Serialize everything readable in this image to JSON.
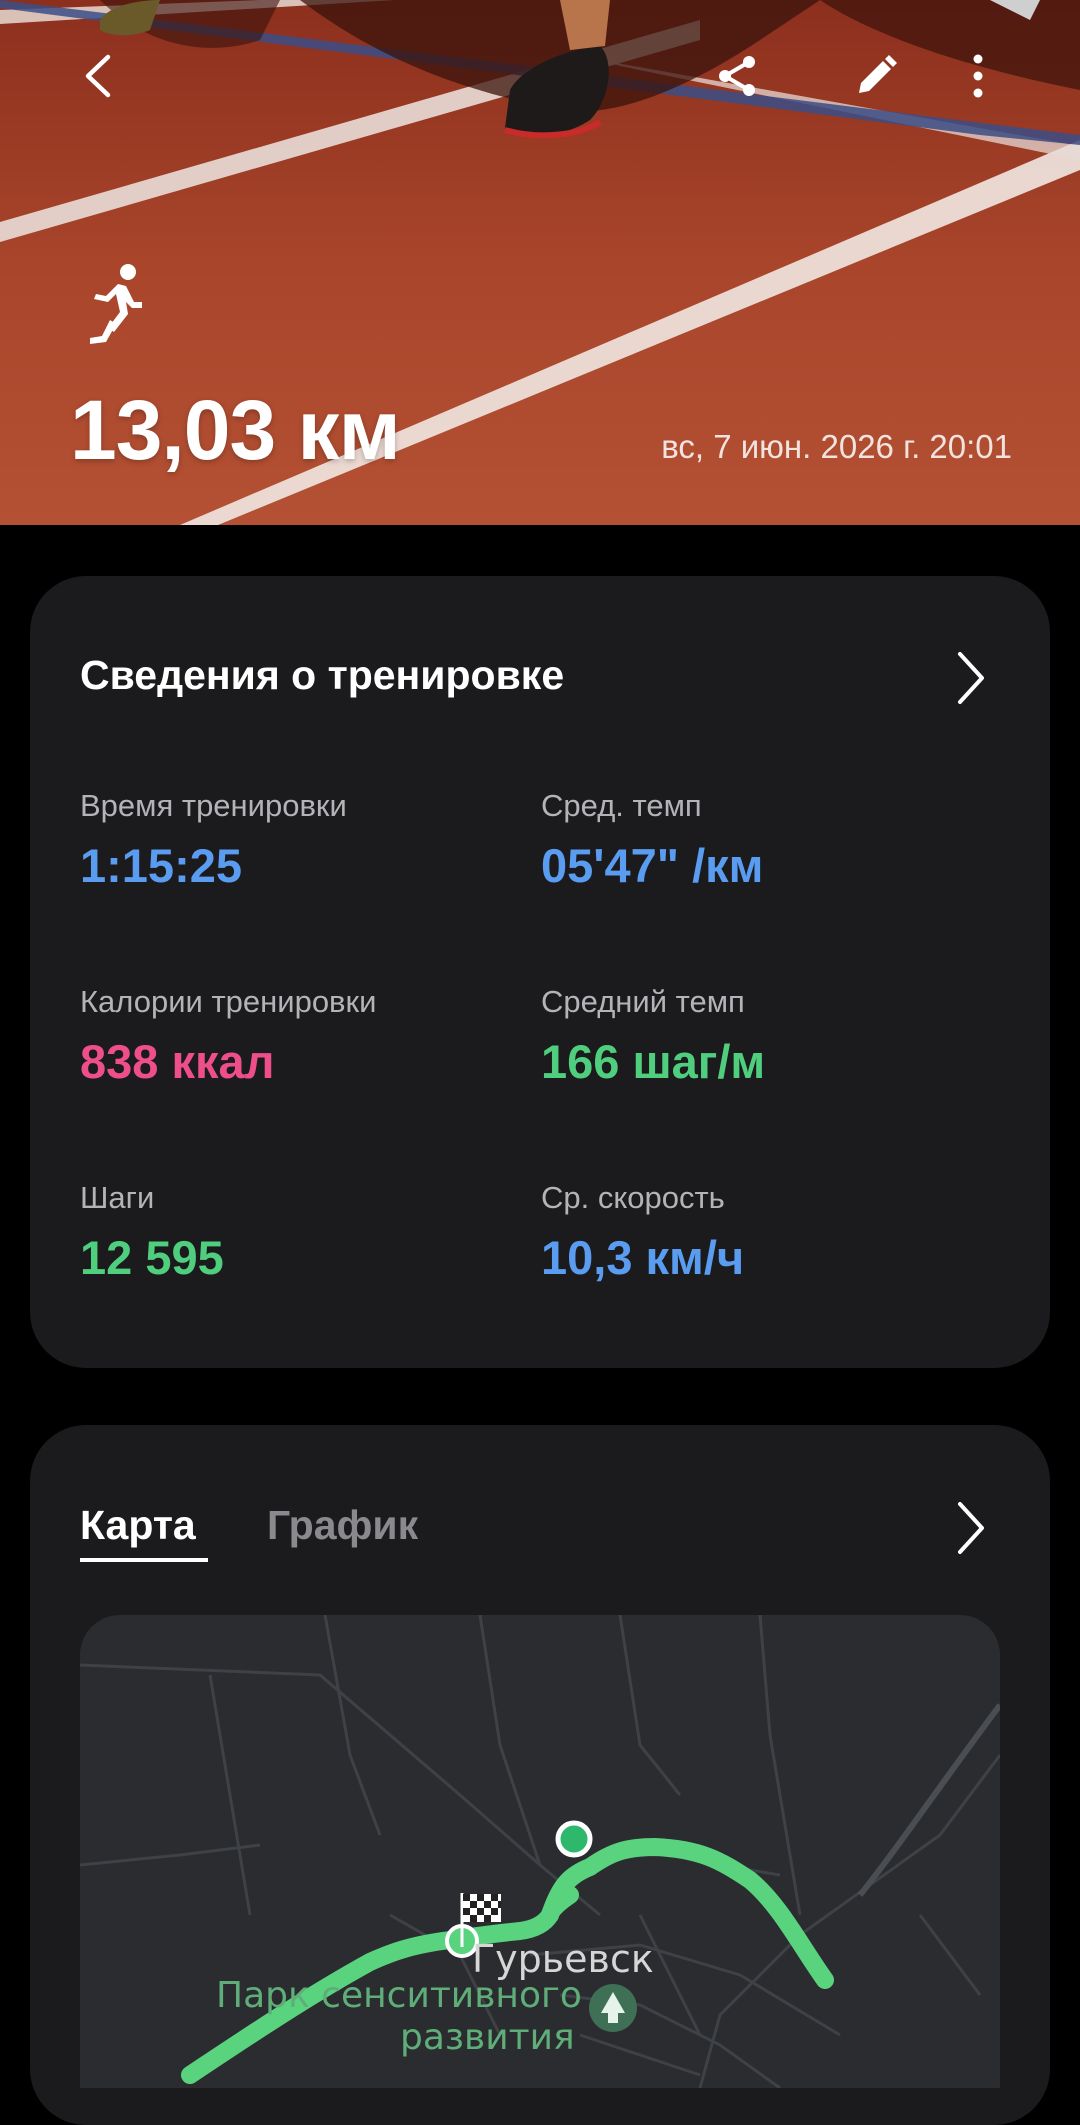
{
  "header": {
    "distance": "13,03 км",
    "datetime": "вс, 7 июн. 2026 г. 20:01",
    "icons": {
      "back": "back-arrow-icon",
      "share": "share-icon",
      "edit": "edit-pencil-icon",
      "more": "more-vertical-icon",
      "activity": "running-person-icon"
    }
  },
  "details": {
    "title": "Сведения о тренировке",
    "stats": [
      {
        "label": "Время тренировки",
        "value": "1:15:25",
        "color": "#5a9cf0"
      },
      {
        "label": "Сред. темп",
        "value": "05'47\" /км",
        "color": "#5a9cf0"
      },
      {
        "label": "Калории тренировки",
        "value": "838 ккал",
        "color": "#ee4f8a"
      },
      {
        "label": "Средний темп",
        "value": "166 шаг/м",
        "color": "#4fce7e"
      },
      {
        "label": "Шаги",
        "value": "12 595",
        "color": "#4fce7e"
      },
      {
        "label": "Ср. скорость",
        "value": "10,3 км/ч",
        "color": "#5a9cf0"
      }
    ]
  },
  "map_section": {
    "tabs": [
      {
        "label": "Карта",
        "active": true
      },
      {
        "label": "График",
        "active": false
      }
    ],
    "map": {
      "city_label": "Гурьевск",
      "park_label_line1": "Парк сенситивного",
      "park_label_line2": "развития",
      "route_color": "#5ad37f"
    }
  },
  "colors": {
    "background": "#000000",
    "card": "#1b1b1d",
    "track": "#9a3a24"
  }
}
